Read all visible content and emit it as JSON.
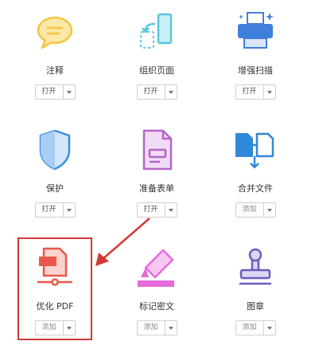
{
  "tools": [
    {
      "label": "注释",
      "action": "打开",
      "icon": "comment-icon"
    },
    {
      "label": "组织页面",
      "action": "打开",
      "icon": "organize-pages-icon"
    },
    {
      "label": "增强扫描",
      "action": "打开",
      "icon": "enhance-scan-icon"
    },
    {
      "label": "保护",
      "action": "打开",
      "icon": "shield-icon"
    },
    {
      "label": "准备表单",
      "action": "打开",
      "icon": "prepare-form-icon"
    },
    {
      "label": "合并文件",
      "action": "添加",
      "icon": "combine-files-icon"
    },
    {
      "label": "优化 PDF",
      "action": "添加",
      "icon": "optimize-pdf-icon"
    },
    {
      "label": "标记密文",
      "action": "添加",
      "icon": "redact-icon"
    },
    {
      "label": "图章",
      "action": "添加",
      "icon": "stamp-icon"
    }
  ],
  "colors": {
    "comment": "#f5c542",
    "organize": "#5bc7dd",
    "scan": "#3f7fd9",
    "protect": "#3a8ee8",
    "form": "#b466c9",
    "combine": "#2f88d8",
    "optimize": "#e8584a",
    "redact": "#e66ad8",
    "stamp": "#6b5bbf",
    "highlight": "#d03a36"
  }
}
